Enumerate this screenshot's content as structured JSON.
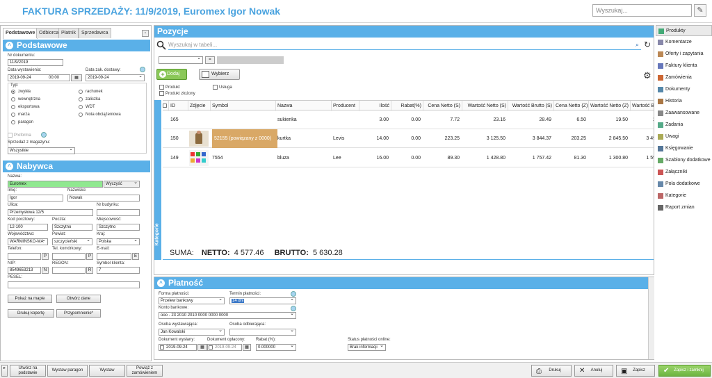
{
  "title": "FAKTURA SPRZEDAŻY: 11/9/2019, Euromex Igor Nowak",
  "search_placeholder": "Wyszukaj...",
  "left": {
    "tabs": [
      "Podstawowe",
      "Odbiorca",
      "Płatnik",
      "Sprzedawca"
    ],
    "section_basic": "Podstawowe",
    "nr_label": "Nr dokumentu:",
    "nr_value": "11/9/2019",
    "data_wyst_label": "Data wystawienia:",
    "data_wyst_value": "2019-09-24",
    "data_wyst_time": "00:00",
    "data_dost_label": "Data zak. dostawy:",
    "data_dost_value": "2019-09-24",
    "typ_label": "Typ:",
    "types_col1": [
      "zwykła",
      "wewnętrzna",
      "eksportowa",
      "marża",
      "paragon"
    ],
    "types_col2": [
      "rachunek",
      "zaliczka",
      "WDT",
      "Nota obciążeniowa"
    ],
    "proforma_label": "Proforma",
    "magazyn_label": "Sprzedaż z magazynu:",
    "magazyn_value": "Wszystkie",
    "section_buyer": "Nabywca",
    "nazwa_label": "Nazwa:",
    "nazwa_value": "Euromex",
    "wyczysc": "Wyczyść",
    "imie_label": "Imię:",
    "imie_value": "Igor",
    "nazwisko_label": "Nazwisko:",
    "nazwisko_value": "Nowak",
    "ulica_label": "Ulica:",
    "ulica_value": "Przemysłowa 12/5",
    "nrbud_label": "Nr budynku:",
    "kod_label": "Kod pocztowy:",
    "kod_value": "12-100",
    "poczta_label": "Poczta:",
    "poczta_value": "Szczytno",
    "miejsc_label": "Miejscowość:",
    "miejsc_value": "Szczytno",
    "woj_label": "Województwo:",
    "woj_value": "WARMIŃSKO-MA",
    "powiat_label": "Powiat:",
    "powiat_value": "szczycieński",
    "kraj_label": "Kraj:",
    "kraj_value": "Polska",
    "tel_label": "Telefon:",
    "telkom_label": "Tel. komórkowy:",
    "email_label": "E-mail:",
    "nip_label": "NIP:",
    "nip_value": "8549653213",
    "regon_label": "REGON:",
    "symbol_label": "Symbol klienta:",
    "symbol_value": "7",
    "pesel_label": "PESEL:",
    "btn_p": "P",
    "btn_e": "E",
    "btn_n": "N",
    "btn_r": "R",
    "btn_map": "Pokaż na mapie",
    "btn_open": "Otwórz dane",
    "btn_envelope": "Drukuj kopertę",
    "btn_reminder": "Przypomnienie*"
  },
  "positions": {
    "header": "Pozycje",
    "search_placeholder": "Wyszukaj w tabeli...",
    "eq": "=",
    "add": "Dodaj",
    "choose": "Wybierz",
    "filter_produkt": "Produkt",
    "filter_usluga": "Usługa",
    "filter_zlozony": "Produkt złożony",
    "side_label": "Kategorie",
    "columns": [
      "ID",
      "Zdjęcie",
      "Symbol",
      "Nazwa",
      "Producent",
      "Ilość",
      "Rabat(%)",
      "Cena Netto (S)",
      "Wartość Netto (S)",
      "Wartość Brutto (S)",
      "Cena Netto (Z)",
      "Wartość Netto (Z)",
      "Wartość Bru"
    ],
    "rows": [
      {
        "id": "165",
        "symbol": "",
        "nazwa": "sukienka",
        "producent": "",
        "ilosc": "3.00",
        "rabat": "0.00",
        "cena_s": "7.72",
        "wn_s": "23.16",
        "wb_s": "28.49",
        "cena_z": "6.50",
        "wn_z": "19.50",
        "wb_z": "2"
      },
      {
        "id": "150",
        "symbol": "52155 (powiązany z 0000)",
        "nazwa": "kurtka",
        "producent": "Levis",
        "ilosc": "14.00",
        "rabat": "0.00",
        "cena_s": "223.25",
        "wn_s": "3 125.50",
        "wb_s": "3 844.37",
        "cena_z": "203.25",
        "wn_z": "2 845.50",
        "wb_z": "3 49"
      },
      {
        "id": "149",
        "symbol": "7554",
        "nazwa": "bluza",
        "producent": "Lee",
        "ilosc": "16.00",
        "rabat": "0.00",
        "cena_s": "89.30",
        "wn_s": "1 428.80",
        "wb_s": "1 757.42",
        "cena_z": "81.30",
        "wn_z": "1 300.80",
        "wb_z": "1 59"
      }
    ],
    "suma_label": "SUMA:",
    "netto_label": "NETTO:",
    "netto_value": "4 577.46",
    "brutto_label": "BRUTTO:",
    "brutto_value": "5 630.28"
  },
  "side_menu": [
    "Produkty",
    "Komentarze",
    "Oferty i zapytania",
    "Faktury klienta",
    "Zamówienia",
    "Dokumenty",
    "Historia",
    "Zaawansowane",
    "Zadania",
    "Uwagi",
    "Księgowanie",
    "Szablony dodatkowe",
    "Załączniki",
    "Pola dodatkowe",
    "Kategorie",
    "Raport zmian"
  ],
  "payment": {
    "header": "Płatność",
    "forma_label": "Forma płatności:",
    "forma_value": "Przelew bankowy",
    "termin_label": "Termin płatności:",
    "termin_value": "14 dni",
    "konto_label": "Konto bankowe:",
    "konto_value": "ooo - 23 2010 2010 0000 0000 0000",
    "wyst_label": "Osoba wystawiająca:",
    "wyst_value": "Jan Kowalski",
    "odb_label": "Osoba odbierająca:",
    "dok_wyslany_label": "Dokument wysłany:",
    "dok_wyslany_value": "2019-09-24",
    "dok_oplacony_label": "Dokument opłacony:",
    "dok_oplacony_value": "2019-09-24",
    "rabat_label": "Rabat (%):",
    "rabat_value": "0.000000",
    "status_label": "Status płatności online:",
    "status_value": "Brak informacji"
  },
  "bottom": {
    "btn1": "Utwórz na podstawie",
    "btn2": "Wystaw paragon",
    "btn3": "Wystaw",
    "btn4": "Powiąż z zamówieniem",
    "print": "Drukuj",
    "cancel": "Anuluj",
    "save": "Zapisz",
    "save_close": "Zapisz i zamknij"
  },
  "colors": {
    "accent": "#5ab0e8",
    "title": "#4aa3df",
    "green": "#7ec850",
    "highlight_row": "#d9a866"
  }
}
